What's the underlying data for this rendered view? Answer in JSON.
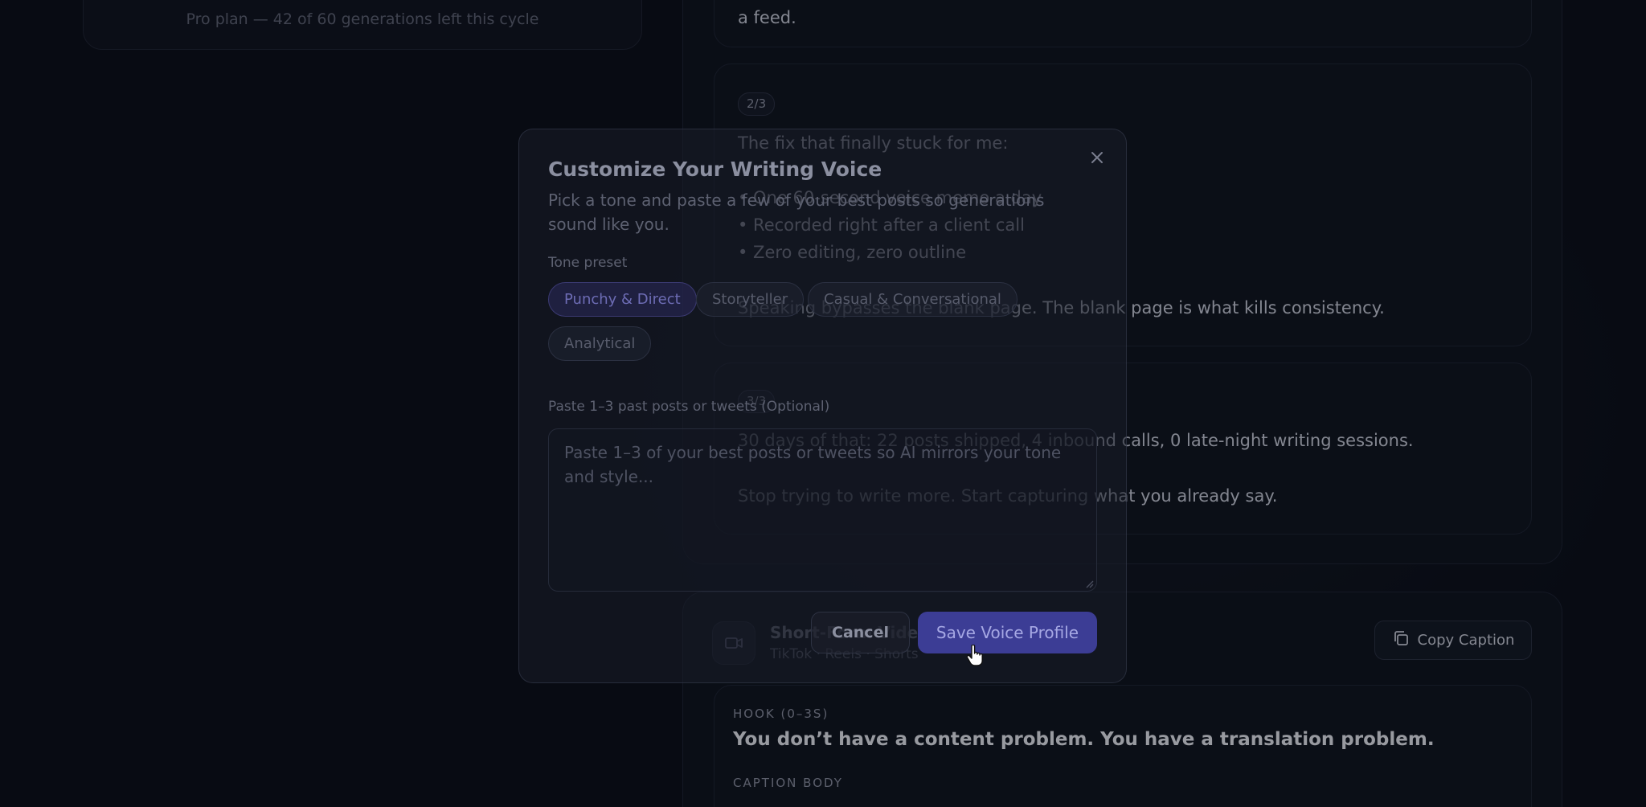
{
  "usage": {
    "text": "Pro plan — 42 of 60 generations left this cycle"
  },
  "thread": {
    "card1": {
      "tail": "a feed."
    },
    "card2": {
      "badge": "2/3",
      "intro": "The fix that finally stuck for me:",
      "bullets": [
        "• One 60-second voice memo a day",
        "• Recorded right after a client call",
        "• Zero editing, zero outline"
      ],
      "closing": "Speaking bypasses the blank page. The blank page is what kills consistency."
    },
    "card3": {
      "badge": "3/3",
      "line1": "30 days of that: 22 posts shipped, 4 inbound calls, 0 late-night writing sessions.",
      "line2": "Stop trying to write more. Start capturing what you already say."
    }
  },
  "video": {
    "icon": "video-camera-icon",
    "title": "Short-Form Video Caption",
    "subtitle": "TikTok · Reels · Shorts",
    "copy_label": "Copy Caption",
    "copy_icon": "copy-icon",
    "hook_label": "HOOK (0–3S)",
    "hook_text": "You don’t have a content problem. You have a translation problem.",
    "body_label": "CAPTION BODY"
  },
  "modal": {
    "title": "Customize Your Writing Voice",
    "description": "Pick a tone and paste a few of your best posts so generations sound like you.",
    "close_icon": "close-icon",
    "tone_label": "Tone preset",
    "tones": [
      "Punchy & Direct",
      "Storyteller",
      "Casual & Conversational",
      "Analytical"
    ],
    "selected_tone": "Punchy & Direct",
    "samples_label": "Paste 1–3 past posts or tweets (Optional)",
    "samples_placeholder": "Paste 1–3 of your best posts or tweets so AI mirrors your tone and style...",
    "cancel_label": "Cancel",
    "save_label": "Save Voice Profile"
  },
  "colors": {
    "accent": "#3c3d95",
    "background": "#0a0d16"
  }
}
